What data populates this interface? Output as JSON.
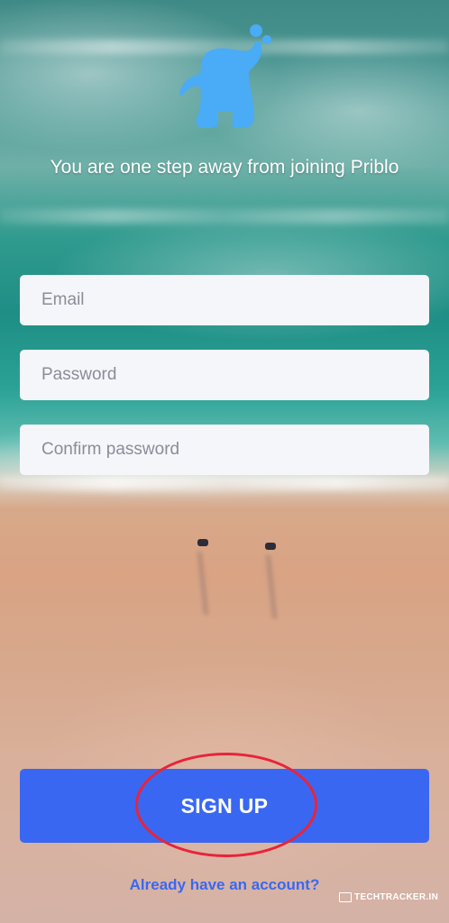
{
  "app": {
    "name": "Priblo"
  },
  "header": {
    "title": "You are one step away from joining Priblo"
  },
  "form": {
    "email_placeholder": "Email",
    "password_placeholder": "Password",
    "confirm_password_placeholder": "Confirm password"
  },
  "actions": {
    "signup_label": "SIGN UP",
    "login_link": "Already have an account?"
  },
  "watermark": {
    "text": "TECHTRACKER.IN"
  },
  "colors": {
    "primary": "#3a67f2",
    "logo": "#4aabf6",
    "annotation": "#e8243a",
    "field_bg": "#f5f6fa"
  },
  "icons": {
    "logo": "elephant-logo-icon"
  }
}
